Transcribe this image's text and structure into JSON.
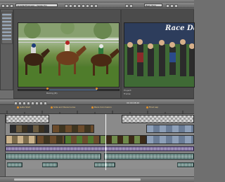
{
  "window": {
    "file_label": "racedayfinal.veg - Vegas Pro"
  },
  "preview": {
    "tab_label": "Best (Full)",
    "title_overlay": "Race Da",
    "status_project": "Project:",
    "status_frame": "Frame:"
  },
  "trimmer": {
    "label": "Racing (R)"
  },
  "timeline": {
    "timecode": "00:00:08;20",
    "marker_labels": [
      "Gate Start",
      "Side and Racecourse",
      "Race Conclusion",
      "Final Lap"
    ]
  },
  "colors": {
    "selection_blue": "#7fa6d6",
    "marker_orange": "#e0922a",
    "cursor_yellow": "#ffd24a",
    "audio_teal": "#a9cfc9",
    "audio_purple": "#b4a8d8"
  }
}
